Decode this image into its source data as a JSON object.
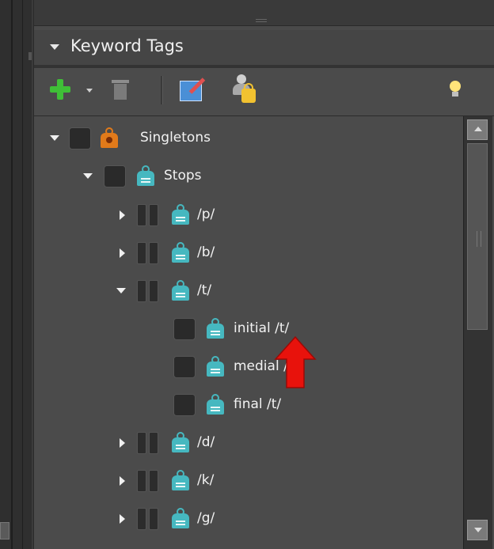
{
  "panel": {
    "title": "Keyword Tags"
  },
  "toolbar": {
    "icons": [
      "add-icon",
      "dropdown-arrow-icon",
      "trash-icon",
      "edit-icon",
      "person-lock-icon",
      "lightbulb-icon"
    ]
  },
  "tree": {
    "root": {
      "label": "Singletons",
      "icon": "orange-tag-icon",
      "expanded": true
    },
    "group": {
      "label": "Stops",
      "icon": "teal-tag-icon",
      "expanded": true
    },
    "items": [
      {
        "label": "/p/",
        "expanded": false
      },
      {
        "label": "/b/",
        "expanded": false
      },
      {
        "label": "/t/",
        "expanded": true
      },
      {
        "label": "initial /t/"
      },
      {
        "label": "medial /t/"
      },
      {
        "label": "final /t/"
      },
      {
        "label": "/d/",
        "expanded": false
      },
      {
        "label": "/k/",
        "expanded": false
      },
      {
        "label": "/g/",
        "expanded": false
      }
    ]
  },
  "colors": {
    "panel_bg": "#4b4b4b",
    "tag_teal": "#46b8c0",
    "tag_orange": "#e17a1a",
    "annotation_arrow": "#e8120c"
  }
}
